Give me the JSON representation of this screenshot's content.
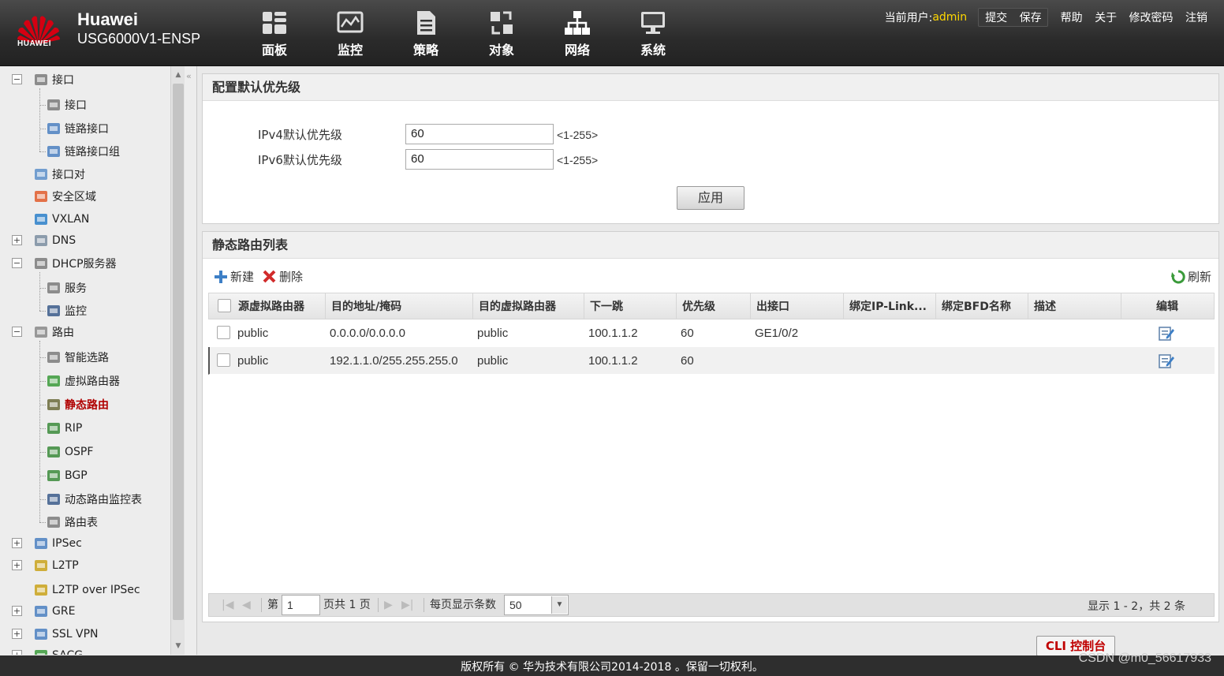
{
  "header": {
    "brand_line1": "Huawei",
    "brand_line2": "USG6000V1-ENSP",
    "logo_text": "HUAWEI",
    "nav": [
      {
        "label": "面板",
        "icon": "dashboard-icon"
      },
      {
        "label": "监控",
        "icon": "monitor-icon"
      },
      {
        "label": "策略",
        "icon": "policy-icon"
      },
      {
        "label": "对象",
        "icon": "object-icon"
      },
      {
        "label": "网络",
        "icon": "network-icon"
      },
      {
        "label": "系统",
        "icon": "system-icon"
      }
    ],
    "current_user_label": "当前用户:",
    "current_user": "admin",
    "actions": {
      "commit": "提交",
      "save": "保存",
      "help": "帮助",
      "about": "关于",
      "change_password": "修改密码",
      "logout": "注销"
    }
  },
  "sidebar": {
    "items": [
      {
        "label": "接口",
        "level": 0,
        "toggle": "−"
      },
      {
        "label": "接口",
        "level": 1
      },
      {
        "label": "链路接口",
        "level": 1
      },
      {
        "label": "链路接口组",
        "level": 1
      },
      {
        "label": "接口对",
        "level": 0
      },
      {
        "label": "安全区域",
        "level": 0
      },
      {
        "label": "VXLAN",
        "level": 0
      },
      {
        "label": "DNS",
        "level": 0,
        "toggle": "+"
      },
      {
        "label": "DHCP服务器",
        "level": 0,
        "toggle": "−"
      },
      {
        "label": "服务",
        "level": 1
      },
      {
        "label": "监控",
        "level": 1
      },
      {
        "label": "路由",
        "level": 0,
        "toggle": "−"
      },
      {
        "label": "智能选路",
        "level": 1
      },
      {
        "label": "虚拟路由器",
        "level": 1
      },
      {
        "label": "静态路由",
        "level": 1,
        "active": true
      },
      {
        "label": "RIP",
        "level": 1
      },
      {
        "label": "OSPF",
        "level": 1
      },
      {
        "label": "BGP",
        "level": 1
      },
      {
        "label": "动态路由监控表",
        "level": 1
      },
      {
        "label": "路由表",
        "level": 1
      },
      {
        "label": "IPSec",
        "level": 0,
        "toggle": "+"
      },
      {
        "label": "L2TP",
        "level": 0,
        "toggle": "+"
      },
      {
        "label": "L2TP over IPSec",
        "level": 0
      },
      {
        "label": "GRE",
        "level": 0,
        "toggle": "+"
      },
      {
        "label": "SSL VPN",
        "level": 0,
        "toggle": "+"
      },
      {
        "label": "SACG",
        "level": 0,
        "toggle": "+"
      }
    ]
  },
  "priority_panel": {
    "title": "配置默认优先级",
    "ipv4_label": "IPv4默认优先级",
    "ipv4_value": "60",
    "ipv4_hint": "<1-255>",
    "ipv6_label": "IPv6默认优先级",
    "ipv6_value": "60",
    "ipv6_hint": "<1-255>",
    "apply_label": "应用"
  },
  "route_panel": {
    "title": "静态路由列表",
    "new_label": "新建",
    "delete_label": "删除",
    "refresh_label": "刷新",
    "columns": [
      "源虚拟路由器",
      "目的地址/掩码",
      "目的虚拟路由器",
      "下一跳",
      "优先级",
      "出接口",
      "绑定IP-Link...",
      "绑定BFD名称",
      "描述",
      "编辑"
    ],
    "rows": [
      {
        "src_vr": "public",
        "dest": "0.0.0.0/0.0.0.0",
        "dest_vr": "public",
        "next_hop": "100.1.1.2",
        "priority": "60",
        "out_if": "GE1/0/2",
        "ip_link": "",
        "bfd": "",
        "desc": ""
      },
      {
        "src_vr": "public",
        "dest": "192.1.1.0/255.255.255.0",
        "dest_vr": "public",
        "next_hop": "100.1.1.2",
        "priority": "60",
        "out_if": "",
        "ip_link": "",
        "bfd": "",
        "desc": ""
      }
    ],
    "pager": {
      "page_prefix": "第",
      "page_value": "1",
      "page_suffix": "页共 1 页",
      "per_page_label": "每页显示条数",
      "per_page_value": "50",
      "summary": "显示 1 - 2，共 2 条"
    }
  },
  "cli_label": "CLI 控制台",
  "footer": "版权所有 © 华为技术有限公司2014-2018 。保留一切权利。",
  "watermark": "CSDN @m0_56617933",
  "colors": {
    "header_bg": "#2b2b2b",
    "user_highlight": "#ffd800",
    "active_item": "#b00000",
    "brand_red": "#d50012"
  }
}
